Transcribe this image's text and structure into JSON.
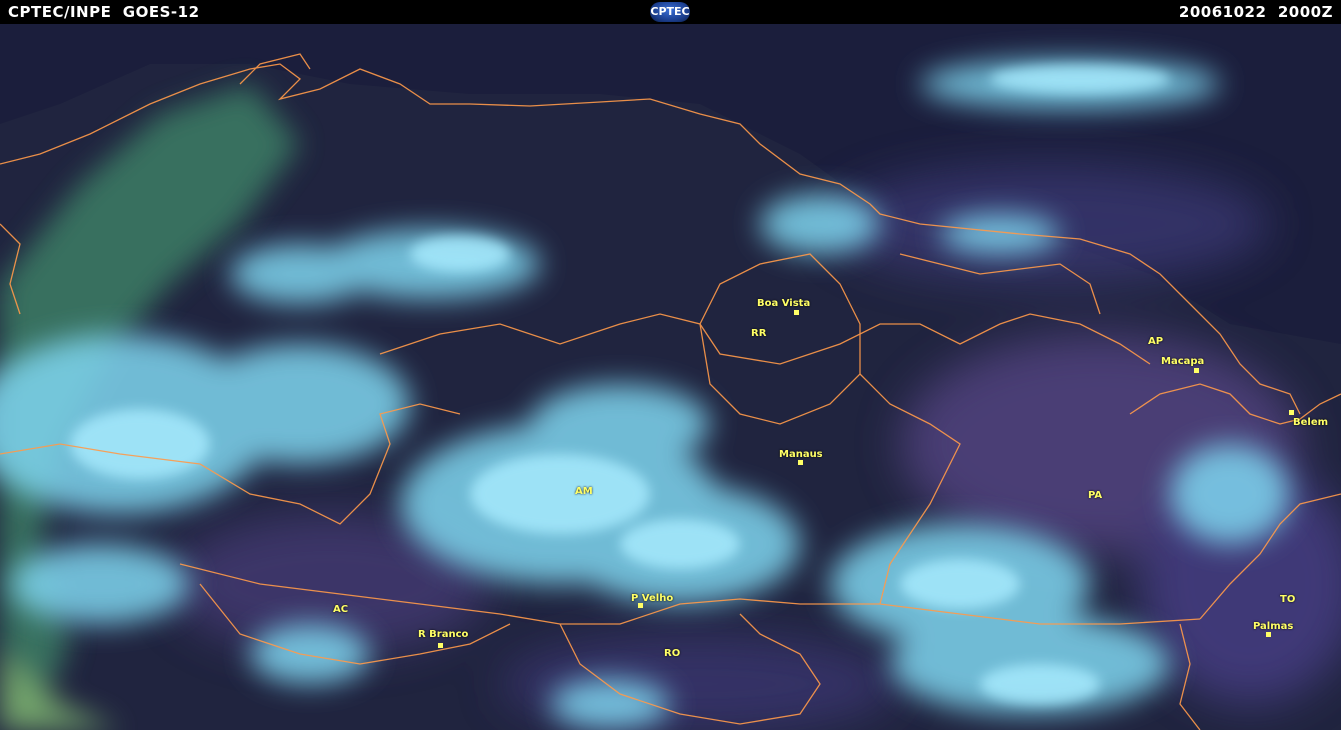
{
  "header": {
    "left_text": "CPTEC/INPE  GOES-12",
    "logo_text": "CPTEC",
    "right_text": "20061022  2000Z"
  },
  "map": {
    "colors": {
      "background": "#20243f",
      "clouds": "#7fd6f0",
      "borders": "#ff9a4a",
      "labels": "#ffff66"
    },
    "states": [
      "RR",
      "AP",
      "AM",
      "PA",
      "AC",
      "RO",
      "TO"
    ],
    "cities": [
      "Boa Vista",
      "Macapa",
      "Belem",
      "Manaus",
      "P Velho",
      "R Branco",
      "Palmas"
    ]
  }
}
